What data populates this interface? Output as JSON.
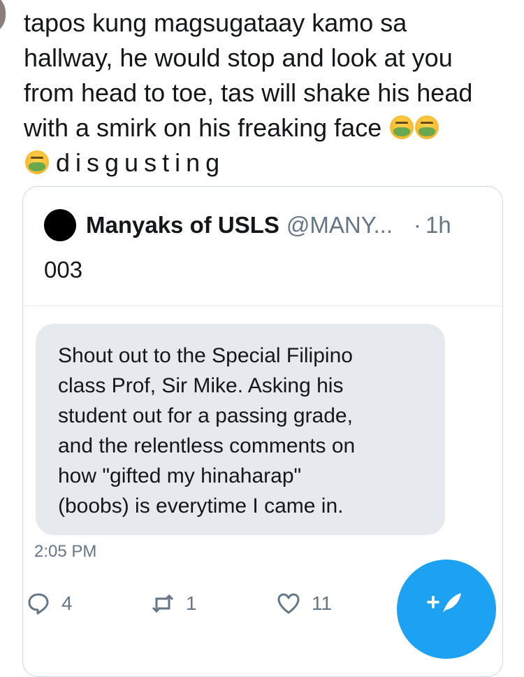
{
  "tweet": {
    "lines": [
      "tapos kung magsugataay kamo sa",
      "hallway, he would stop and look at you",
      "from head to toe, tas will shake his head",
      "with a smirk on his freaking face"
    ],
    "last_word": "disgusting",
    "emoji": "nauseated-face-icon"
  },
  "quoted_tweet": {
    "name": "Manyaks of USLS",
    "handle": "@MANY...",
    "separator": "·",
    "time": "1h",
    "text": "003",
    "image_text_lines": [
      "Shout out to the Special Filipino",
      "class Prof, Sir Mike. Asking his",
      "student out for a passing grade,",
      "and the relentless comments on",
      "how \"gifted my hinaharap\"",
      "(boobs) is everytime I came in."
    ],
    "image_timestamp": "2:05 PM"
  },
  "actions": {
    "reply_count": "4",
    "retweet_count": "1",
    "like_count": "11"
  },
  "compose_label": "+",
  "colors": {
    "accent": "#1da1f2",
    "muted": "#657786",
    "bubble": "#e6e9ee"
  }
}
